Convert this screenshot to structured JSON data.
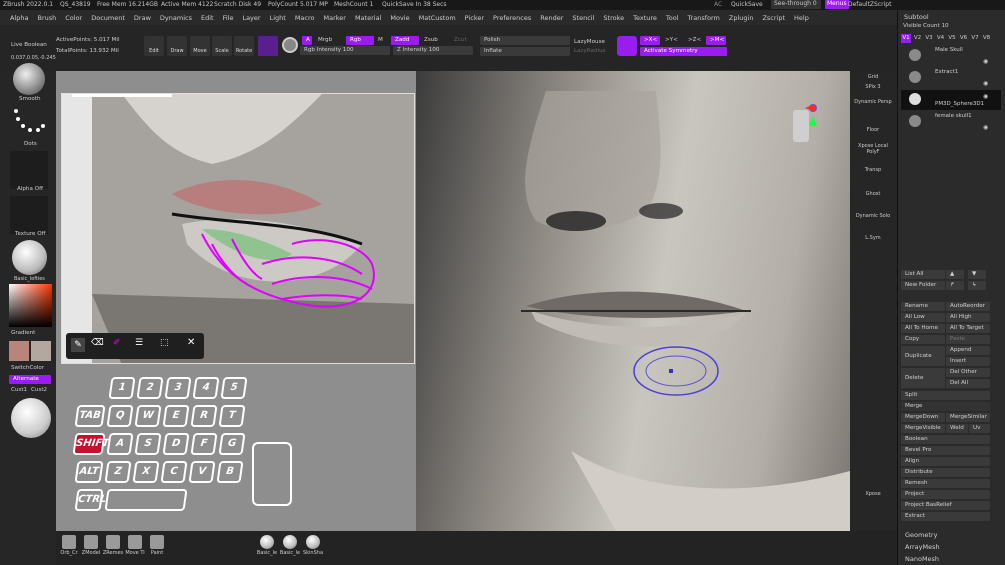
{
  "status_bar": {
    "app": "ZBrush 2022.0.1",
    "project": "QS_43819",
    "free_mem": "Free Mem 16.214GB",
    "active_mem": "Active Mem 4122",
    "scratch": "Scratch Disk 49",
    "polycount": "PolyCount 5.017 MP",
    "meshcount": "MeshCount 1",
    "quicksave_timer": "QuickSave In 38 Secs",
    "ac": "AC",
    "quicksave_btn": "QuickSave",
    "see_through": "See-through",
    "see_through_val": "0",
    "menus_btn": "Menus",
    "script": "DefaultZScript"
  },
  "menu": [
    "Alpha",
    "Brush",
    "Color",
    "Document",
    "Draw",
    "Dynamics",
    "Edit",
    "File",
    "Layer",
    "Light",
    "Macro",
    "Marker",
    "Material",
    "Movie",
    "MatCustom",
    "Picker",
    "Preferences",
    "Render",
    "Stencil",
    "Stroke",
    "Texture",
    "Tool",
    "Transform",
    "Zplugin",
    "Zscript",
    "Help"
  ],
  "toolbar": {
    "live_boolean": "Live Boolean",
    "coords": "0.037,0.05,-0.245",
    "active_points": "ActivePoints: 5.017 Mil",
    "total_points": "TotalPoints: 13.932 Mil",
    "edit": "Edit",
    "draw": "Draw",
    "move": "Move",
    "scale": "Scale",
    "rotate": "Rotate",
    "a": "A",
    "mrgb": "Mrgb",
    "rgb": "Rgb",
    "m": "M",
    "zadd": "Zadd",
    "zsub": "Zsub",
    "zcut": "Zcut",
    "rgb_intensity": "Rgb Intensity 100",
    "z_intensity": "Z Intensity 100",
    "polish": "Polish",
    "inflate": "Inflate",
    "lazymouse": "LazyMouse",
    "lazyradius": "LazyRadius",
    "sym_x": ">X<",
    "sym_y": ">Y<",
    "sym_z": ">Z<",
    "sym_m": ">M<",
    "activate_symmetry": "Activate Symmetry"
  },
  "left_shelf": {
    "smooth": "Smooth",
    "dots": "Dots",
    "alpha_off": "Alpha Off",
    "texture_off": "Texture Off",
    "material": "Basic_lefties",
    "gradient": "Gradient",
    "switch_color": "SwitchColor",
    "alternate": "Alternate",
    "cust1": "Cust1",
    "cust2": "Cust2"
  },
  "right_shelf": [
    "Grid",
    "SPix 3",
    "Dynamic Persp",
    "Floor",
    "Xpose Local PolyF",
    "Transp",
    "Ghost",
    "Dynamic Solo",
    "L.Sym",
    "Xpose"
  ],
  "bottom_shelf": {
    "tools": [
      "Orb_Cr",
      "ZModel",
      "ZRemes",
      "Move Ti",
      "Paint"
    ],
    "materials": [
      "Basic_le",
      "Basic_le",
      "SkinSha"
    ]
  },
  "subtool": {
    "title": "Subtool",
    "visible_count": "Visible Count 10",
    "tabs": [
      "V1",
      "V2",
      "V3",
      "V4",
      "V5",
      "V6",
      "V7",
      "V8"
    ],
    "items": [
      "Male Skull",
      "Extract1",
      "PM3D_Sphere3D1",
      "female skull1"
    ],
    "list_all": "List All",
    "new_folder": "New Folder",
    "rename": "Rename",
    "auto_reorder": "AutoReorder",
    "all_low": "All Low",
    "all_high": "All High",
    "all_to_home": "All To Home",
    "all_to_target": "All To Target",
    "copy": "Copy",
    "paste": "Paste",
    "duplicate": "Duplicate",
    "append": "Append",
    "insert": "Insert",
    "delete": "Delete",
    "del_other": "Del Other",
    "del_all": "Del All",
    "split": "Split",
    "merge": "Merge",
    "merge_down": "MergeDown",
    "merge_similar": "MergeSimilar",
    "merge_visible": "MergeVisible",
    "weld": "Weld",
    "uv": "Uv",
    "boolean": "Boolean",
    "bevel_pro": "Bevel Pro",
    "align": "Align",
    "distribute": "Distribute",
    "remesh": "Remesh",
    "project": "Project",
    "project_basrelief": "Project BasRelief",
    "extract": "Extract",
    "geometry": "Geometry",
    "arraymesh": "ArrayMesh",
    "nanomesh": "NanoMesh"
  },
  "keyboard": {
    "row1": [
      "1",
      "2",
      "3",
      "4",
      "5"
    ],
    "row2": [
      "Q",
      "W",
      "E",
      "R",
      "T"
    ],
    "row3": [
      "A",
      "S",
      "D",
      "F",
      "G"
    ],
    "row4": [
      "Z",
      "X",
      "C",
      "V",
      "B"
    ],
    "tab": "TAB",
    "shift": "SHIFT",
    "alt": "ALT",
    "ctrl": "CTRL"
  },
  "colors": {
    "accent": "#9b1cf0",
    "brush_ring": "#4a3fd6",
    "shift_key": "#c8102e",
    "stroke": "#e000ff"
  }
}
